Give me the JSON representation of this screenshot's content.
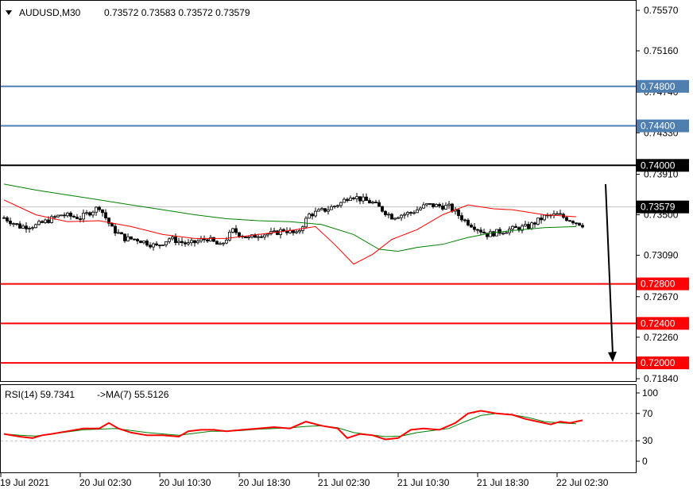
{
  "header": {
    "menu_icon": "triangle-down-icon",
    "symbol": "AUDUSD,M30",
    "ohlc": "0.73572 0.73583 0.73572 0.73579"
  },
  "rsi_header": {
    "label": "RSI(14) 59.7341",
    "ma_label": "->MA(7) 55.5126"
  },
  "colors": {
    "level_blue": "#4f7fb1",
    "level_red": "#ff0000",
    "level_black": "#000000",
    "ma_fast": "#ff0000",
    "ma_slow": "#008000",
    "rsi_line": "#ff0000",
    "rsi_ma": "#008000",
    "current_price": "#c0c0c0"
  },
  "chart_data": [
    {
      "type": "candlestick",
      "symbol": "AUDUSD",
      "timeframe": "M30",
      "y_ticks": [
        "0.75570",
        "0.75160",
        "0.74740",
        "0.74330",
        "0.73910",
        "0.73500",
        "0.73090",
        "0.72670",
        "0.72260",
        "0.71840"
      ],
      "ylim": [
        0.7184,
        0.7557
      ],
      "x_ticks": [
        "19 Jul 2021",
        "20 Jul 02:30",
        "20 Jul 10:30",
        "20 Jul 18:30",
        "21 Jul 02:30",
        "21 Jul 10:30",
        "21 Jul 18:30",
        "22 Jul 02:30"
      ],
      "current_price": {
        "value": 0.73579,
        "label": "0.73579"
      },
      "levels": [
        {
          "value": 0.748,
          "label": "0.74800",
          "color": "blue"
        },
        {
          "value": 0.744,
          "label": "0.74400",
          "color": "blue"
        },
        {
          "value": 0.74,
          "label": "0.74000",
          "color": "black"
        },
        {
          "value": 0.728,
          "label": "0.72800",
          "color": "red"
        },
        {
          "value": 0.724,
          "label": "0.72400",
          "color": "red"
        },
        {
          "value": 0.72,
          "label": "0.72000",
          "color": "red"
        }
      ],
      "close_path": [
        [
          0,
          0.7347
        ],
        [
          5,
          0.7338
        ],
        [
          10,
          0.7339
        ],
        [
          18,
          0.735
        ],
        [
          24,
          0.7347
        ],
        [
          30,
          0.7358
        ],
        [
          34,
          0.7336
        ],
        [
          38,
          0.7326
        ],
        [
          42,
          0.7325
        ],
        [
          48,
          0.7318
        ],
        [
          52,
          0.7326
        ],
        [
          58,
          0.732
        ],
        [
          64,
          0.7326
        ],
        [
          68,
          0.7318
        ],
        [
          72,
          0.7334
        ],
        [
          77,
          0.7326
        ],
        [
          80,
          0.733
        ],
        [
          85,
          0.7331
        ],
        [
          88,
          0.7335
        ],
        [
          92,
          0.733
        ],
        [
          96,
          0.735
        ],
        [
          102,
          0.7356
        ],
        [
          106,
          0.7362
        ],
        [
          109,
          0.737
        ],
        [
          112,
          0.7366
        ],
        [
          116,
          0.7362
        ],
        [
          122,
          0.7348
        ],
        [
          128,
          0.7352
        ],
        [
          133,
          0.736
        ],
        [
          140,
          0.7358
        ],
        [
          145,
          0.7344
        ],
        [
          152,
          0.733
        ],
        [
          159,
          0.7335
        ],
        [
          165,
          0.7338
        ],
        [
          170,
          0.7348
        ],
        [
          174,
          0.735
        ],
        [
          178,
          0.7345
        ],
        [
          182,
          0.734
        ]
      ],
      "ma_fast_path": [
        [
          0,
          0.7365
        ],
        [
          10,
          0.735
        ],
        [
          20,
          0.7343
        ],
        [
          30,
          0.7344
        ],
        [
          40,
          0.7338
        ],
        [
          50,
          0.733
        ],
        [
          60,
          0.7326
        ],
        [
          70,
          0.7326
        ],
        [
          80,
          0.733
        ],
        [
          90,
          0.7334
        ],
        [
          98,
          0.7338
        ],
        [
          104,
          0.732
        ],
        [
          110,
          0.73
        ],
        [
          116,
          0.731
        ],
        [
          122,
          0.7325
        ],
        [
          130,
          0.7335
        ],
        [
          138,
          0.735
        ],
        [
          146,
          0.736
        ],
        [
          154,
          0.7356
        ],
        [
          160,
          0.7355
        ],
        [
          170,
          0.735
        ],
        [
          180,
          0.7348
        ]
      ],
      "ma_slow_path": [
        [
          0,
          0.7381
        ],
        [
          10,
          0.7375
        ],
        [
          20,
          0.737
        ],
        [
          30,
          0.7365
        ],
        [
          40,
          0.736
        ],
        [
          50,
          0.7355
        ],
        [
          60,
          0.735
        ],
        [
          70,
          0.7346
        ],
        [
          80,
          0.7344
        ],
        [
          90,
          0.7343
        ],
        [
          100,
          0.734
        ],
        [
          110,
          0.733
        ],
        [
          118,
          0.7315
        ],
        [
          124,
          0.7313
        ],
        [
          130,
          0.7317
        ],
        [
          138,
          0.732
        ],
        [
          146,
          0.7327
        ],
        [
          154,
          0.7332
        ],
        [
          160,
          0.7334
        ],
        [
          170,
          0.7337
        ],
        [
          180,
          0.7338
        ]
      ],
      "annotation": {
        "type": "arrow",
        "from": 0.7381,
        "to": 0.7201
      }
    },
    {
      "type": "line",
      "title": "RSI(14) 59.7341",
      "y_ticks": [
        "100",
        "70",
        "30",
        "0"
      ],
      "ylim": [
        0,
        100
      ],
      "levels": [
        70,
        30
      ],
      "rsi_path": [
        [
          0,
          40
        ],
        [
          5,
          36
        ],
        [
          9,
          34
        ],
        [
          12,
          38
        ],
        [
          15,
          40
        ],
        [
          20,
          44
        ],
        [
          25,
          48
        ],
        [
          30,
          48
        ],
        [
          33,
          56
        ],
        [
          36,
          48
        ],
        [
          40,
          42
        ],
        [
          45,
          38
        ],
        [
          50,
          38
        ],
        [
          55,
          36
        ],
        [
          58,
          44
        ],
        [
          62,
          46
        ],
        [
          66,
          46
        ],
        [
          70,
          44
        ],
        [
          75,
          46
        ],
        [
          80,
          48
        ],
        [
          85,
          50
        ],
        [
          90,
          48
        ],
        [
          95,
          58
        ],
        [
          100,
          52
        ],
        [
          105,
          48
        ],
        [
          108,
          34
        ],
        [
          112,
          40
        ],
        [
          116,
          38
        ],
        [
          120,
          32
        ],
        [
          124,
          34
        ],
        [
          128,
          46
        ],
        [
          132,
          48
        ],
        [
          137,
          46
        ],
        [
          142,
          56
        ],
        [
          146,
          70
        ],
        [
          150,
          74
        ],
        [
          155,
          70
        ],
        [
          160,
          68
        ],
        [
          164,
          62
        ],
        [
          168,
          58
        ],
        [
          172,
          54
        ],
        [
          175,
          58
        ],
        [
          178,
          56
        ],
        [
          182,
          60
        ]
      ],
      "rsi_ma_path": [
        [
          0,
          40
        ],
        [
          5,
          38
        ],
        [
          10,
          37
        ],
        [
          15,
          40
        ],
        [
          20,
          43
        ],
        [
          25,
          46
        ],
        [
          30,
          47
        ],
        [
          35,
          48
        ],
        [
          40,
          45
        ],
        [
          45,
          42
        ],
        [
          50,
          40
        ],
        [
          55,
          38
        ],
        [
          60,
          41
        ],
        [
          65,
          44
        ],
        [
          70,
          44
        ],
        [
          75,
          45
        ],
        [
          80,
          47
        ],
        [
          85,
          48
        ],
        [
          90,
          49
        ],
        [
          95,
          51
        ],
        [
          100,
          52
        ],
        [
          105,
          49
        ],
        [
          110,
          42
        ],
        [
          115,
          39
        ],
        [
          120,
          36
        ],
        [
          125,
          37
        ],
        [
          130,
          42
        ],
        [
          135,
          45
        ],
        [
          140,
          48
        ],
        [
          145,
          58
        ],
        [
          150,
          67
        ],
        [
          155,
          70
        ],
        [
          160,
          68
        ],
        [
          165,
          64
        ],
        [
          170,
          58
        ],
        [
          175,
          56
        ],
        [
          180,
          55
        ]
      ]
    }
  ]
}
